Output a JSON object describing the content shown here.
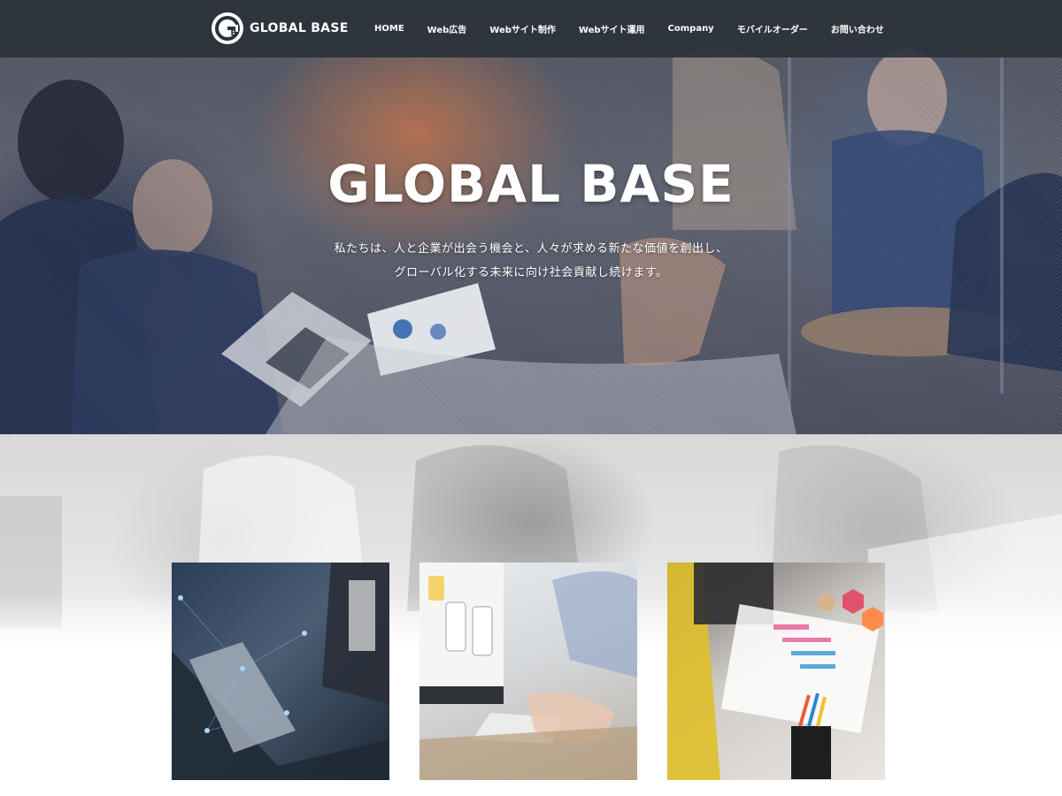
{
  "header": {
    "logo_text": "GLOBAL BASE",
    "nav": [
      {
        "label": "HOME"
      },
      {
        "label": "Web広告"
      },
      {
        "label": "Webサイト制作"
      },
      {
        "label": "Webサイト運用"
      },
      {
        "label": "Company"
      },
      {
        "label": "モバイルオーダー"
      },
      {
        "label": "お問い合わせ"
      }
    ]
  },
  "hero": {
    "title": "GLOBAL BASE",
    "line1": "私たちは、人と企業が出会う機会と、人々が求める新たな価値を創出し、",
    "line2": "グローバル化する未来に向け社会貢献し続けます。"
  },
  "colors": {
    "header_bg": "#2a323a",
    "text_light": "#ffffff"
  }
}
